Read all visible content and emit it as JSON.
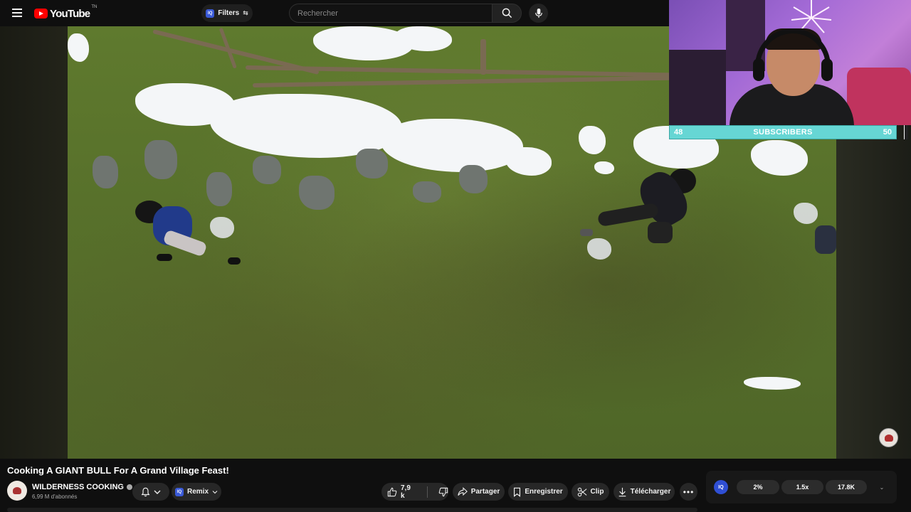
{
  "header": {
    "logo_text": "YouTube",
    "logo_tm": "TN",
    "filters_label": "Filters",
    "filters_badge": "IQ",
    "search_placeholder": "Rechercher"
  },
  "webcam": {
    "sub_goal_current": "48",
    "sub_goal_label": "SUBSCRIBERS",
    "sub_goal_target": "50",
    "progress_fraction": 0.96
  },
  "video": {
    "title": "Cooking A GIANT BULL For A Grand Village Feast!"
  },
  "channel": {
    "name": "WILDERNESS COOKING",
    "subscribers": "6,99 M d'abonnés"
  },
  "actions": {
    "remix_badge": "IQ",
    "remix_label": "Remix",
    "like_count": "7,9 k",
    "share_label": "Partager",
    "save_label": "Enregistrer",
    "clip_label": "Clip",
    "download_label": "Télécharger",
    "more_label": "•••"
  },
  "stats_panel": {
    "iq_label": "IQ",
    "stat_1": "2%",
    "stat_2": "1.5x",
    "stat_3": "17.8K",
    "chevron": "⌄"
  },
  "colors": {
    "youtube_red": "#ff0000",
    "sub_bar": "#66d6d4",
    "iq_blue": "#2f4fd4"
  }
}
